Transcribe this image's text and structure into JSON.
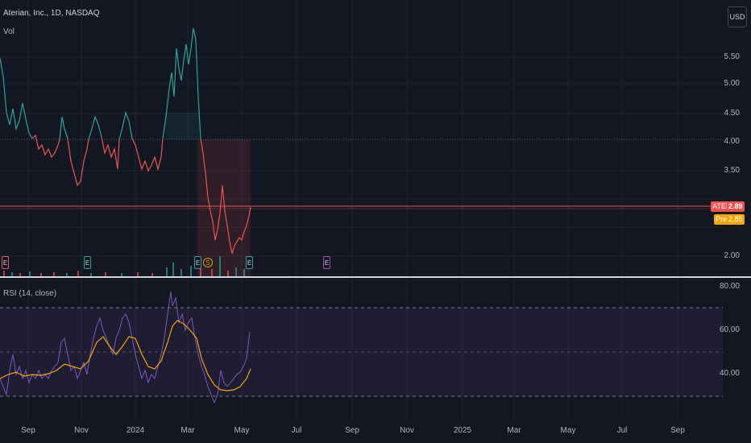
{
  "header": {
    "symbol": "Aterian, Inc., 1D, NASDAQ",
    "volume_label": "Vol",
    "currency": "USD"
  },
  "price_axis": {
    "ticks": [
      "5.50",
      "5.00",
      "4.50",
      "4.00",
      "3.50",
      "2.00"
    ]
  },
  "price_tags": {
    "symbol_tag": "ATER",
    "last_price": "2.89",
    "pre_tag": "Pre",
    "pre_price": "2.85"
  },
  "rsi": {
    "label": "RSI (14, close)",
    "ticks": [
      "80.00",
      "60.00",
      "40.00"
    ]
  },
  "time_axis": {
    "labels": [
      "Sep",
      "Nov",
      "2024",
      "Mar",
      "May",
      "Jul",
      "Sep",
      "Nov",
      "2025",
      "Mar",
      "May",
      "Jul",
      "Sep"
    ]
  },
  "events": [
    {
      "glyph": "E",
      "color": "#ef5350"
    },
    {
      "glyph": "E",
      "color": "#26a69a"
    },
    {
      "glyph": "E",
      "color": "#26a69a"
    },
    {
      "glyph": "S",
      "color": "#f7a600"
    },
    {
      "glyph": "E",
      "color": "#26a69a"
    },
    {
      "glyph": "E",
      "color": "#ab47bc"
    }
  ],
  "colors": {
    "up": "#26a69a",
    "down": "#ef5350",
    "rsi_line": "#7e57c2",
    "rsi_ma": "#f7a600",
    "background": "#131722"
  }
}
